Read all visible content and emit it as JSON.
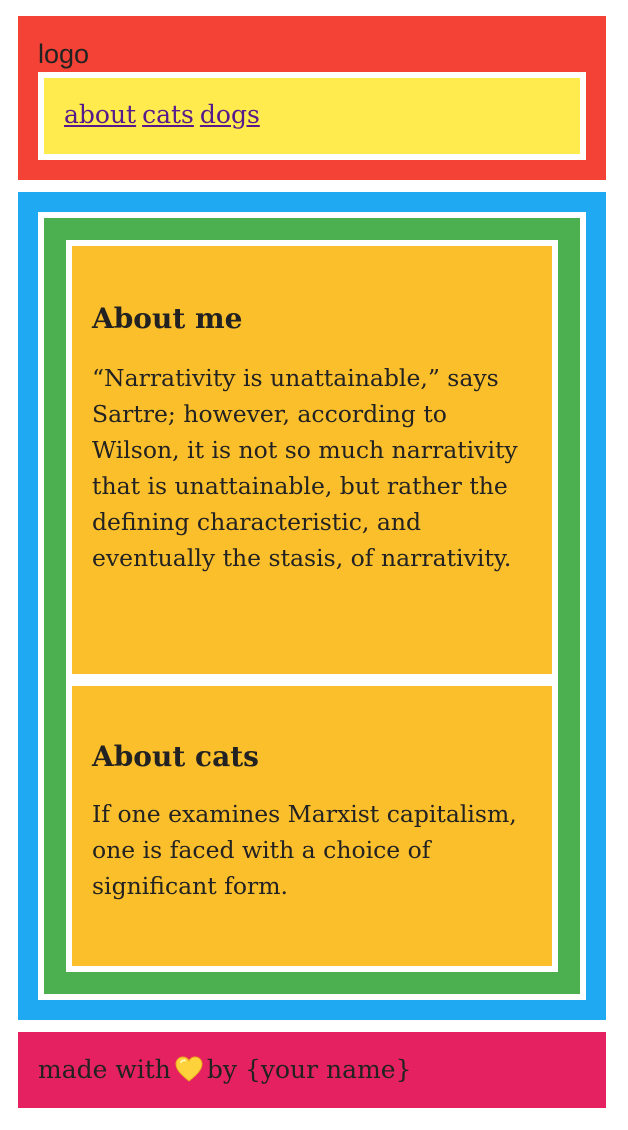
{
  "header": {
    "logo": "logo",
    "nav": {
      "links": [
        "about",
        "cats",
        "dogs"
      ]
    }
  },
  "sections": [
    {
      "heading": "About me",
      "body": "“Narrativity is unattainable,” says Sartre; however, according to Wilson, it is not so much narrativity that is unattainable, but rather the defining characteristic, and eventually the stasis, of narrativity."
    },
    {
      "heading": "About cats",
      "body": "If one examines Marxist capitalism, one is faced with a choice of significant form."
    }
  ],
  "footer": {
    "before": "made with",
    "icon": "yellow-heart-icon",
    "after": "by {your name}"
  },
  "colors": {
    "header": "#f44336",
    "nav": "#ffeb4d",
    "main": "#1ea9f2",
    "inner": "#4caf50",
    "card": "#fbbf2c",
    "footer": "#e52162",
    "link": "#551a8b",
    "heart": "#fdd23b"
  }
}
